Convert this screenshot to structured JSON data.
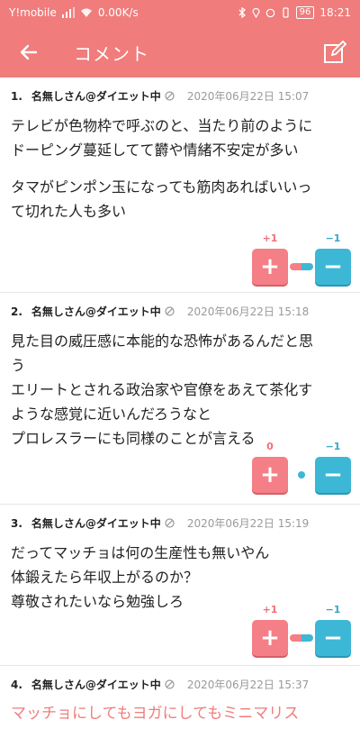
{
  "status_bar": {
    "carrier": "Y!mobile",
    "speed": "0.00K/s",
    "battery": "96",
    "time": "18:21"
  },
  "app_bar": {
    "title": "コメント",
    "back_icon": "arrow-left-icon",
    "edit_icon": "edit-icon"
  },
  "colors": {
    "header": "#f07c7c",
    "plus": "#f47f87",
    "minus": "#3db7d6"
  },
  "comments": [
    {
      "number": "1.",
      "name": "名無しさん@ダイエット中",
      "date": "2020年06月22日 15:07",
      "lines": [
        "テレビが色物枠で呼ぶのと、当たり前のように",
        "ドーピング蔓延してて欝や情緒不安定が多い",
        "",
        "タマがピンポン玉になっても筋肉あればいいっ",
        "て切れた人も多い"
      ],
      "plus": "+1",
      "minus": "−1"
    },
    {
      "number": "2.",
      "name": "名無しさん@ダイエット中",
      "date": "2020年06月22日 15:18",
      "lines": [
        "見た目の威圧感に本能的な恐怖があるんだと思",
        "う",
        "エリートとされる政治家や官僚をあえて茶化す",
        "ような感覚に近いんだろうなと",
        "プロレスラーにも同様のことが言える"
      ],
      "plus": "0",
      "minus": "−1"
    },
    {
      "number": "3.",
      "name": "名無しさん@ダイエット中",
      "date": "2020年06月22日 15:19",
      "lines": [
        "だってマッチョは何の生産性も無いやん",
        "体鍛えたら年収上がるのか？",
        "尊敬されたいなら勉強しろ"
      ],
      "plus": "+1",
      "minus": "−1"
    },
    {
      "number": "4.",
      "name": "名無しさん@ダイエット中",
      "date": "2020年06月22日 15:37",
      "lines": [
        "マッチョにしてもヨガにしてもミニマリス"
      ]
    }
  ],
  "vote_labels": {
    "plus_button": "+",
    "minus_button": "−"
  }
}
